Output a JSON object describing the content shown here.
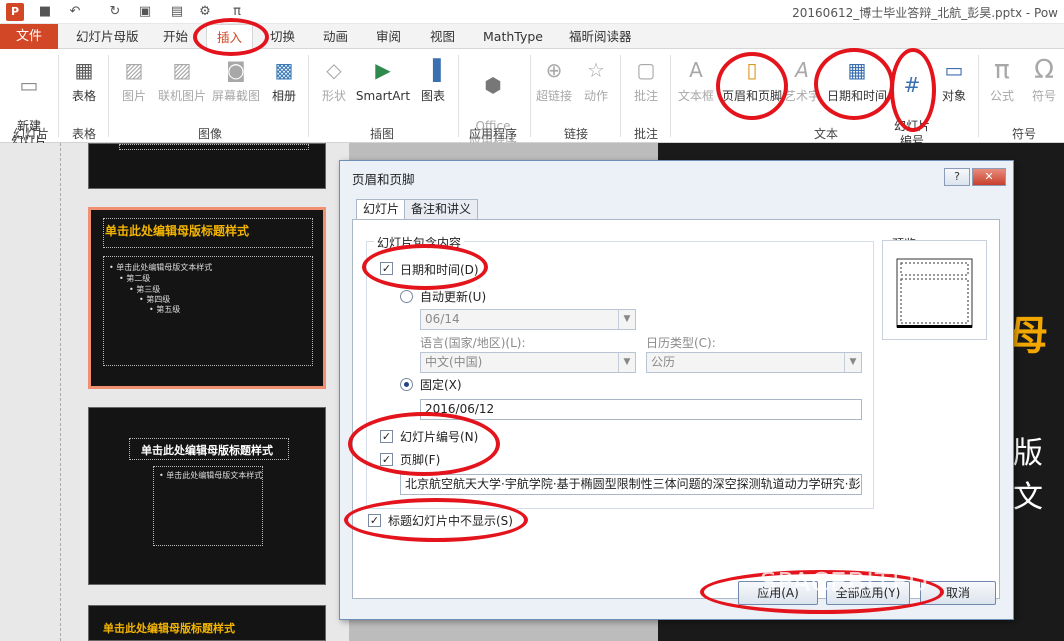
{
  "window": {
    "title": "20160612_博士毕业答辩_北航_彭昊.pptx - Pow",
    "app_logo": "P"
  },
  "tabs": {
    "file": "文件",
    "items": [
      "幻灯片母版",
      "开始",
      "插入",
      "切换",
      "动画",
      "审阅",
      "视图",
      "MathType",
      "福昕阅读器"
    ]
  },
  "ribbon": {
    "new_slide": "新建\n幻灯片",
    "table": "表格",
    "picture": "图片",
    "online_picture": "联机图片",
    "screenshot": "屏幕截图",
    "album": "相册",
    "shapes": "形状",
    "smartart": "SmartArt",
    "chart": "图表",
    "office_apps": "Office\n应用程序",
    "hyperlink": "超链接",
    "action": "动作",
    "comment": "批注",
    "textbox": "文本框",
    "header_footer": "页眉和页脚",
    "wordart": "艺术字",
    "date_time": "日期和时间",
    "slide_number": "幻灯片\n编号",
    "object": "对象",
    "formula": "公式",
    "symbol": "符号",
    "groups": {
      "slides": "幻灯片",
      "tables": "表格",
      "images": "图像",
      "illustrations": "插图",
      "apps": "应用程序",
      "links": "链接",
      "comments": "批注",
      "text": "文本",
      "symbols": "符号"
    }
  },
  "thumbs": {
    "title": "单击此处编辑母版标题样式",
    "body": [
      "• 单击此处编辑母版文本样式",
      "• 第二级",
      "• 第三级",
      "• 第四级",
      "• 第五级"
    ]
  },
  "slide": {
    "big1": "母",
    "big2": "版文"
  },
  "dialog": {
    "title": "页眉和页脚",
    "help": "?",
    "close": "✕",
    "tab_slide": "幻灯片",
    "tab_notes": "备注和讲义",
    "group_label": "幻灯片包含内容",
    "preview_label": "预览",
    "date_time": "日期和时间(D)",
    "auto_update": "自动更新(U)",
    "auto_value": "06/14",
    "language_label": "语言(国家/地区)(L):",
    "language_value": "中文(中国)",
    "calendar_label": "日历类型(C):",
    "calendar_value": "公历",
    "fixed": "固定(X)",
    "fixed_value": "2016/06/12",
    "slide_number": "幻灯片编号(N)",
    "footer": "页脚(F)",
    "footer_value": "北京航空航天大学·宇航学院·基于椭圆型限制性三体问题的深空探测轨道动力学研究·彭昊",
    "dont_show_title": "标题幻灯片中不显示(S)",
    "btn_apply": "应用(A)",
    "btn_apply_all": "全部应用(Y)",
    "btn_cancel": "取消"
  },
  "watermark": "SPACEBITFD"
}
